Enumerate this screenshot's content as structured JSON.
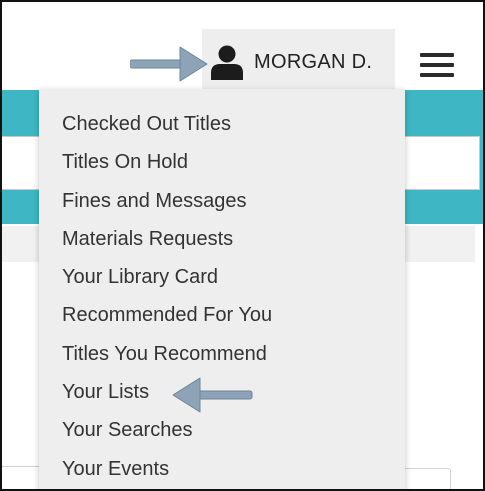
{
  "account": {
    "name": "MORGAN D.",
    "user_icon": "user-icon"
  },
  "menu": {
    "hamburger_icon": "hamburger-menu-icon",
    "items": [
      "Checked Out Titles",
      "Titles On Hold",
      "Fines and Messages",
      "Materials Requests",
      "Your Library Card",
      "Recommended For You",
      "Titles You Recommend",
      "Your Lists",
      "Your Searches",
      "Your Events"
    ]
  },
  "annotations": {
    "arrow_icon": "arrow-right-icon / arrow-left-icon",
    "arrow_color": "#8da3b7"
  },
  "colors": {
    "header_teal": "#3fb6c3",
    "dropdown_bg": "#eeeeee",
    "text": "#333333"
  }
}
